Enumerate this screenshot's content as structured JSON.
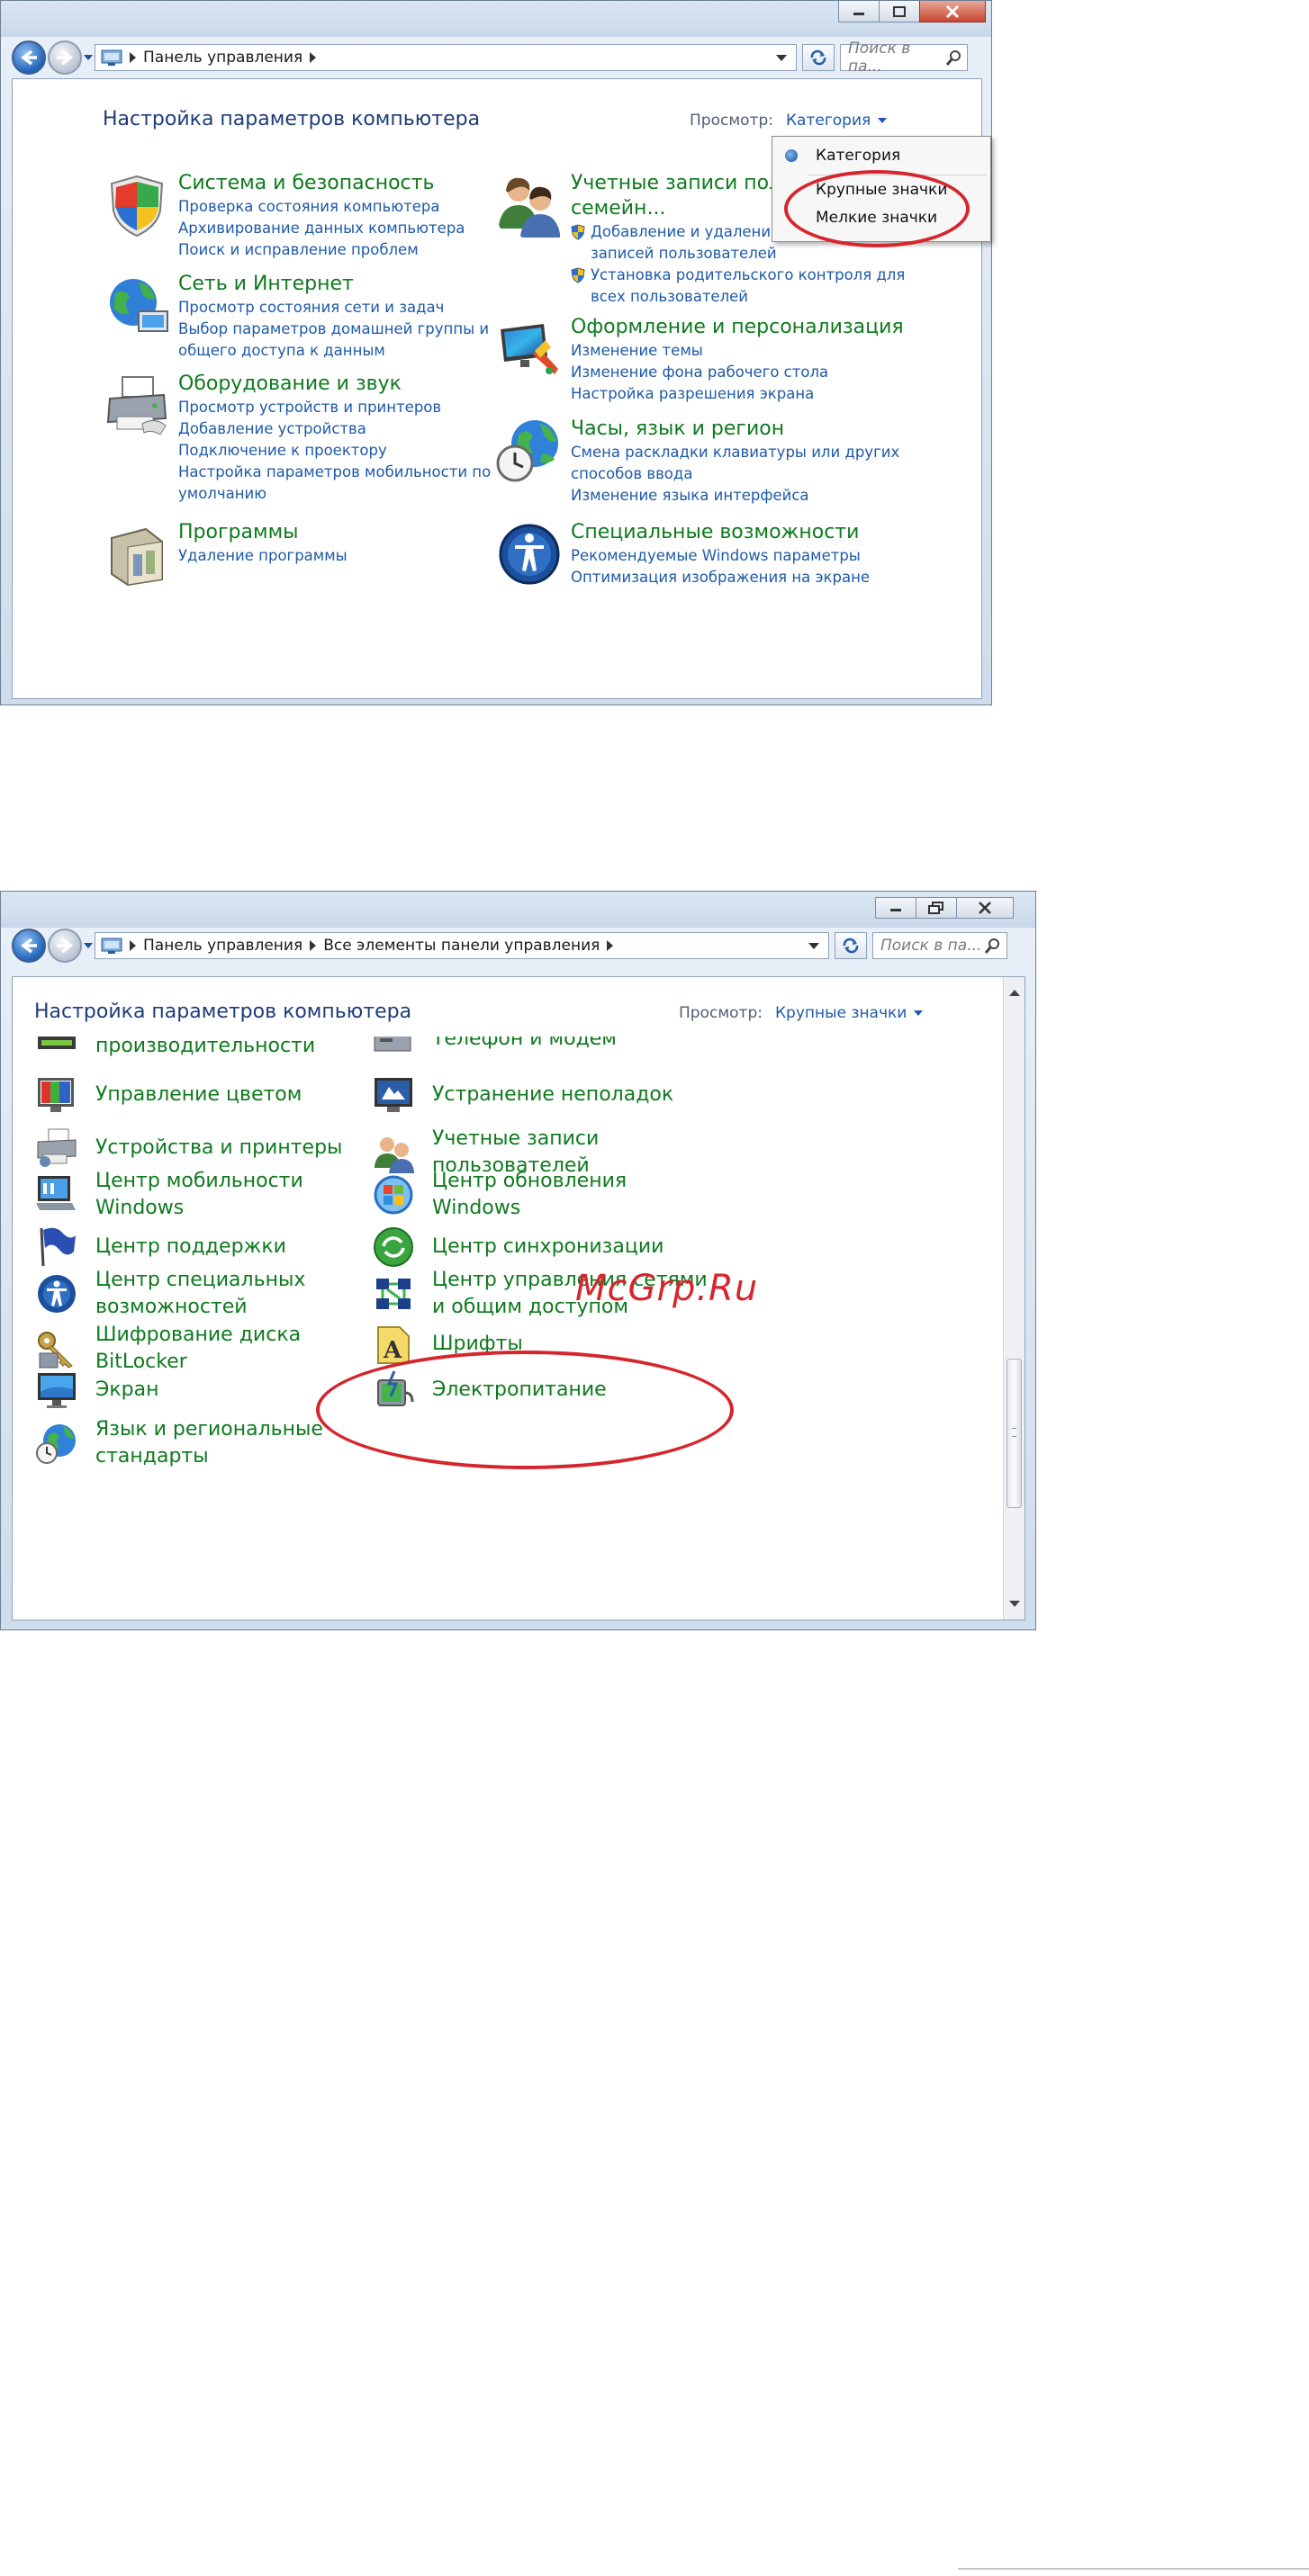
{
  "window1": {
    "breadcrumb": [
      "Панель управления"
    ],
    "search_placeholder": "Поиск в па...",
    "heading": "Настройка параметров компьютера",
    "view_label": "Просмотр:",
    "view_value": "Категория",
    "menu_items": [
      "Категория",
      "Крупные значки",
      "Мелкие значки"
    ],
    "categories": [
      {
        "title": "Система и безопасность",
        "icon": "shield-icon",
        "links": [
          "Проверка состояния компьютера",
          "Архивирование данных компьютера",
          "Поиск и исправление проблем"
        ]
      },
      {
        "title": "Сеть и Интернет",
        "icon": "network-globe-icon",
        "links": [
          "Просмотр состояния сети и задач",
          "Выбор параметров домашней группы и",
          "общего доступа к данным"
        ]
      },
      {
        "title": "Оборудование и звук",
        "icon": "printer-icon",
        "links": [
          "Просмотр устройств и принтеров",
          "Добавление устройства",
          "Подключение к проектору",
          "Настройка параметров мобильности по",
          "умолчанию"
        ]
      },
      {
        "title": "Программы",
        "icon": "programs-icon",
        "links": [
          "Удаление программы"
        ]
      },
      {
        "title": "Учетные записи пользователей и",
        "title_line2": "семейн...",
        "icon": "users-icon",
        "links": [
          "Добавление и удаление у",
          "записей пользователей",
          "Установка родительского контроля для",
          "всех пользователей"
        ]
      },
      {
        "title": "Оформление и персонализация",
        "icon": "appearance-icon",
        "links": [
          "Изменение темы",
          "Изменение фона рабочего стола",
          "Настройка разрешения экрана"
        ]
      },
      {
        "title": "Часы, язык и регион",
        "icon": "clock-globe-icon",
        "links": [
          "Смена раскладки клавиатуры или других",
          "способов ввода",
          "Изменение языка интерфейса"
        ]
      },
      {
        "title": "Специальные возможности",
        "icon": "accessibility-icon",
        "links": [
          "Рекомендуемые Windows параметры",
          "Оптимизация изображения на экране"
        ]
      }
    ]
  },
  "window2": {
    "breadcrumb": [
      "Панель управления",
      "Все элементы панели управления"
    ],
    "search_placeholder": "Поиск в па...",
    "heading": "Настройка параметров компьютера",
    "view_label": "Просмотр:",
    "view_value": "Крупные значки",
    "left_items": [
      {
        "label": "производительности",
        "icon": "performance-icon"
      },
      {
        "label": "Управление цветом",
        "icon": "color-management-icon"
      },
      {
        "label": "Устройства и принтеры",
        "icon": "devices-printers-icon"
      },
      {
        "label": "Центр мобильности\nWindows",
        "icon": "mobility-center-icon"
      },
      {
        "label": "Центр поддержки",
        "icon": "action-center-flag-icon"
      },
      {
        "label": "Центр специальных\nвозможностей",
        "icon": "ease-of-access-icon"
      },
      {
        "label": "Шифрование диска\nBitLocker",
        "icon": "bitlocker-keys-icon"
      },
      {
        "label": "Экран",
        "icon": "display-icon"
      },
      {
        "label": "Язык и региональные\nстандарты",
        "icon": "region-globe-icon"
      }
    ],
    "right_items": [
      {
        "label": "Телефон и модем",
        "icon": "phone-modem-icon"
      },
      {
        "label": "Устранение неполадок",
        "icon": "troubleshooting-icon"
      },
      {
        "label": "Учетные записи\nпользователей",
        "icon": "user-accounts-icon"
      },
      {
        "label": "Центр обновления\nWindows",
        "icon": "windows-update-icon"
      },
      {
        "label": "Центр синхронизации",
        "icon": "sync-center-icon"
      },
      {
        "label": "Центр управления сетями\nи общим доступом",
        "icon": "network-sharing-icon"
      },
      {
        "label": "Шрифты",
        "icon": "fonts-icon"
      },
      {
        "label": "Электропитание",
        "icon": "power-options-icon"
      }
    ]
  },
  "watermark": "McGrp.Ru",
  "colors": {
    "link": "#1e5aa8",
    "category_title": "#0f7a1e",
    "highlight_ring": "#d6262d"
  }
}
